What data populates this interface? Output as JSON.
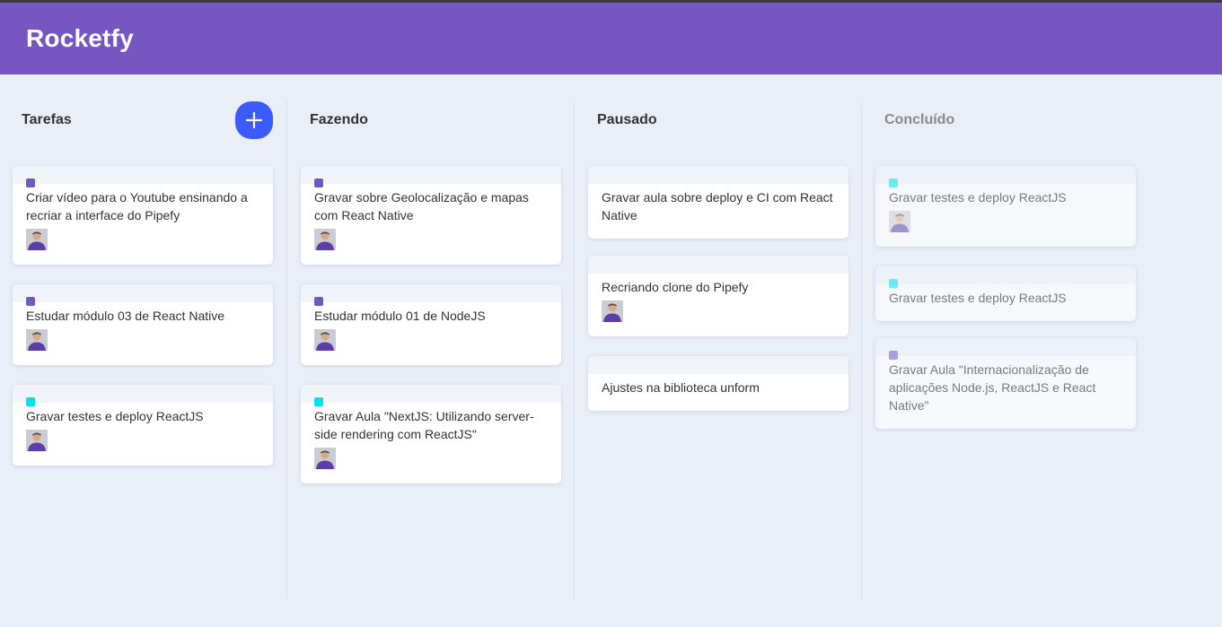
{
  "app": {
    "title": "Rocketfy"
  },
  "colors": {
    "header": "#7656c1",
    "add_button": "#3b5bfd",
    "tag_purple": "#7159c1",
    "tag_cyan": "#00e0f0"
  },
  "lists": [
    {
      "title": "Tarefas",
      "creatable": true,
      "cards": [
        {
          "content": "Criar vídeo para o Youtube ensinando a recriar a interface do Pipefy",
          "label": "#7159c1",
          "has_user": true
        },
        {
          "content": "Estudar módulo 03 de React Native",
          "label": "#7159c1",
          "has_user": true
        },
        {
          "content": "Gravar testes e deploy ReactJS",
          "label": "#00e0f0",
          "has_user": true
        }
      ]
    },
    {
      "title": "Fazendo",
      "creatable": false,
      "cards": [
        {
          "content": "Gravar sobre Geolocalização e mapas com React Native",
          "label": "#7159c1",
          "has_user": true
        },
        {
          "content": "Estudar módulo 01 de NodeJS",
          "label": "#7159c1",
          "has_user": true
        },
        {
          "content": "Gravar Aula \"NextJS: Utilizando server-side rendering com ReactJS\"",
          "label": "#00e0f0",
          "has_user": true
        }
      ]
    },
    {
      "title": "Pausado",
      "creatable": false,
      "cards": [
        {
          "content": "Gravar aula sobre deploy e CI com React Native",
          "label": null,
          "has_user": false
        },
        {
          "content": "Recriando clone do Pipefy",
          "label": null,
          "has_user": true
        },
        {
          "content": "Ajustes na biblioteca unform",
          "label": null,
          "has_user": false
        }
      ]
    },
    {
      "title": "Concluído",
      "creatable": false,
      "done": true,
      "cards": [
        {
          "content": "Gravar testes e deploy ReactJS",
          "label": "#00e0f0",
          "has_user": true
        },
        {
          "content": "Gravar testes e deploy ReactJS",
          "label": "#00e0f0",
          "has_user": false
        },
        {
          "content": "Gravar Aula \"Internacionalização de aplicações Node.js, ReactJS e React Native\"",
          "label": "#7159c1",
          "has_user": false
        }
      ]
    }
  ]
}
